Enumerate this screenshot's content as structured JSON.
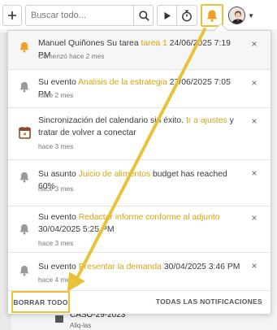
{
  "toolbar": {
    "add_icon": "plus-icon",
    "search_placeholder": "Buscar todo...",
    "search_icon": "search-icon",
    "play_icon": "play-icon",
    "timer_icon": "stopwatch-icon",
    "bell_icon": "bell-icon",
    "avatar_icon": "user-avatar",
    "caret_icon": "chevron-down-icon"
  },
  "notifications": [
    {
      "icon": "bell-icon",
      "icon_color": "#f0a024",
      "unread": true,
      "prefix": "Manuel Quiñones",
      "middle": " Su tarea ",
      "highlight": "tarea 1",
      "suffix": " 24/06/2025 7:19 PM",
      "time": "Comenzó hace 2 mes"
    },
    {
      "icon": "bell-icon",
      "icon_color": "#9a9a9a",
      "unread": false,
      "prefix": "",
      "middle": "Su evento ",
      "highlight": "Analisis de la estrategia",
      "suffix": " 27/06/2025 7:05 PM",
      "time": "hace 2 mes"
    },
    {
      "icon": "calendar-icon",
      "icon_color": "#8b4a2b",
      "unread": false,
      "prefix": "",
      "middle": "Sincronización del calendario sin éxito. ",
      "highlight": "Ir a ajustes",
      "suffix": " y tratar de volver a conectar",
      "time": "hace 3 mes"
    },
    {
      "icon": "bell-icon",
      "icon_color": "#9a9a9a",
      "unread": false,
      "prefix": "",
      "middle": "Su asunto ",
      "highlight": "Juicio de alimentos",
      "suffix": " budget has reached 60%",
      "time": "hace 3 mes"
    },
    {
      "icon": "bell-icon",
      "icon_color": "#9a9a9a",
      "unread": false,
      "prefix": "",
      "middle": "Su evento ",
      "highlight": "Redactar informe conforme al adjunto",
      "suffix": " 30/04/2025 5:25 PM",
      "time": "hace 3 mes"
    },
    {
      "icon": "bell-icon",
      "icon_color": "#9a9a9a",
      "unread": false,
      "prefix": "",
      "middle": "Su evento ",
      "highlight": "Presentar la demanda",
      "suffix": " 30/04/2025 3:46 PM",
      "time": "hace 4 mes"
    }
  ],
  "close_label": "×",
  "footer": {
    "clear_label": "BORRAR TODO",
    "all_label": "TODAS LAS NOTIFICACIONES"
  },
  "background": {
    "case_title": "CASO-29-2023",
    "case_sub": "Aliq-las"
  },
  "colors": {
    "accent": "#e8c33a",
    "highlight_text": "#d6a40f"
  }
}
